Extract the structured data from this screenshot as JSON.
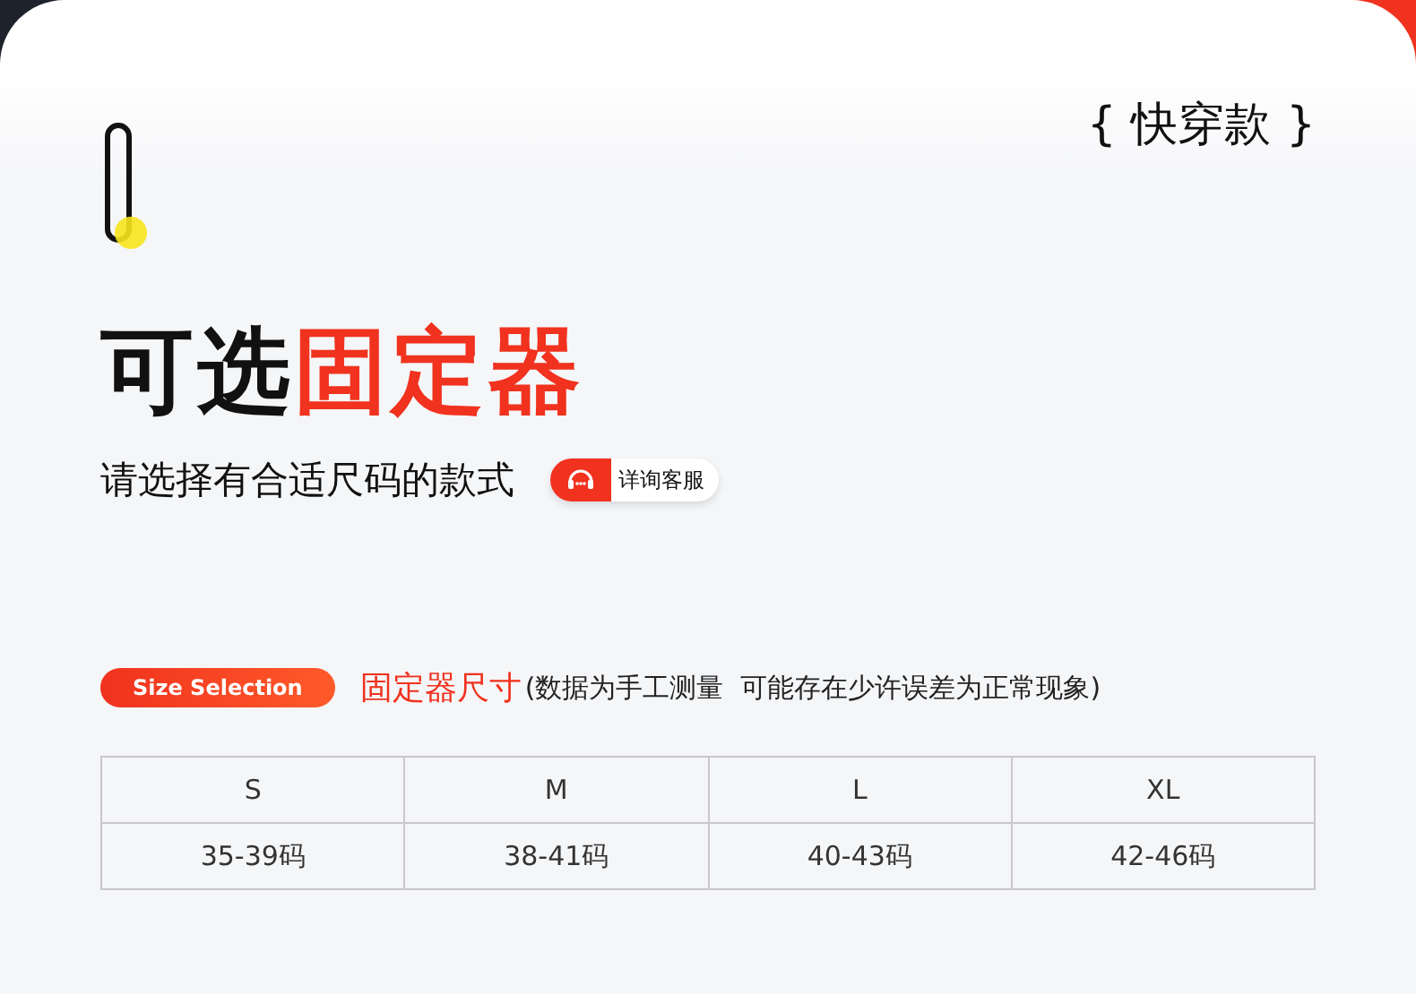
{
  "tag": "{ 快穿款 }",
  "title": [
    {
      "text": "可选",
      "accent": false
    },
    {
      "text": "固定器",
      "accent": true
    }
  ],
  "subtitle": "请选择有合适尺码的款式",
  "service_button": {
    "label": "详询客服"
  },
  "size_badge": "Size Selection",
  "size_heading": "固定器尺寸",
  "size_note": "(数据为手工测量  可能存在少许误差为正常现象)",
  "table": {
    "columns": [
      "S",
      "M",
      "L",
      "XL"
    ],
    "rows": [
      [
        "35-39码",
        "38-41码",
        "40-43码",
        "42-46码"
      ]
    ]
  }
}
